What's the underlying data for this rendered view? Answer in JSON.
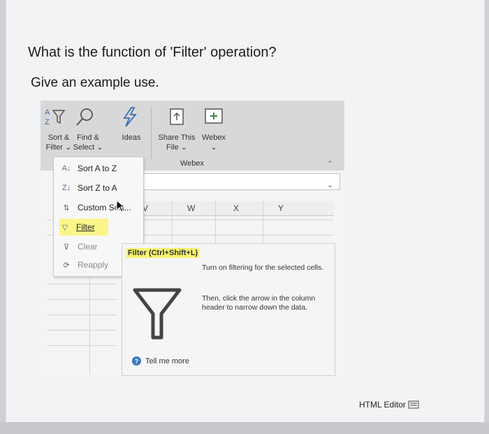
{
  "question": "What is the function of 'Filter' operation?",
  "subquestion": "Give an example use.",
  "ribbon": {
    "sort_filter": {
      "line1": "Sort &",
      "line2": "Filter"
    },
    "find_select": {
      "line1": "Find &",
      "line2": "Select"
    },
    "ideas": "Ideas",
    "share_file": {
      "line1": "Share This",
      "line2": "File"
    },
    "webex": "Webex",
    "webex_group": "Webex"
  },
  "columns": [
    "V",
    "W",
    "X",
    "Y"
  ],
  "menu": {
    "sort_az": "Sort A to Z",
    "sort_za": "Sort Z to A",
    "custom_sort": "Custom Sort...",
    "filter": "Filter",
    "clear": "Clear",
    "reapply": "Reapply"
  },
  "tooltip": {
    "title": "Filter (Ctrl+Shift+L)",
    "description": "Turn on filtering for the selected cells.",
    "description2": "Then, click the arrow in the column header to narrow down the data.",
    "help": "Tell me more"
  },
  "editor_label": "HTML Editor",
  "colors": {
    "highlight": "#fbf58a",
    "accent_blue": "#3a78c2",
    "ribbon": "#d9d8d8"
  }
}
